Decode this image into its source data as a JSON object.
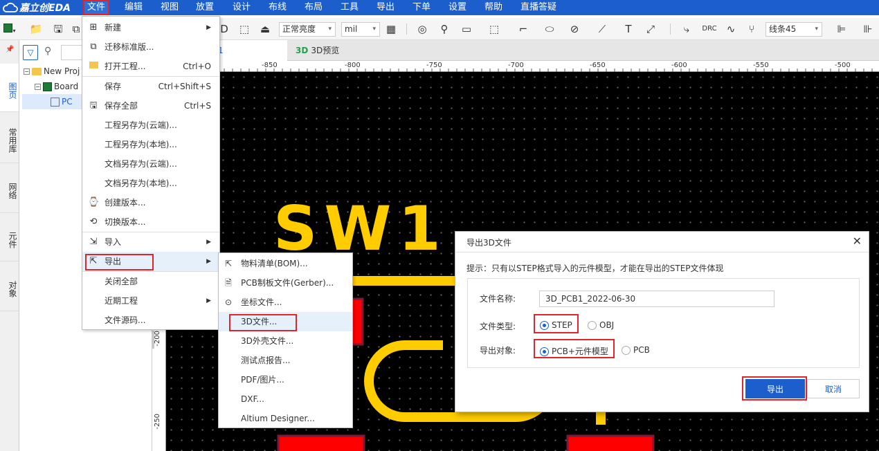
{
  "app": {
    "logo_text": "嘉立创EDA"
  },
  "menubar": {
    "items": [
      "文件",
      "编辑",
      "视图",
      "放置",
      "设计",
      "布线",
      "布局",
      "工具",
      "导出",
      "下单",
      "设置",
      "帮助",
      "直播答疑"
    ]
  },
  "toolbar": {
    "brightness_value": "正常亮度",
    "unit_value": "mil",
    "route_mode_value": "线条45",
    "drc_label": "DRC"
  },
  "sidebar": {
    "tabs": [
      "图页",
      "常用库",
      "网络",
      "元件",
      "对象"
    ]
  },
  "tree": {
    "project": "New Proj",
    "board": "Board",
    "pcb": "PC"
  },
  "doctabs": [
    {
      "label": "1"
    },
    {
      "badge": "3D",
      "label": "3D预览"
    }
  ],
  "ruler": {
    "h_labels": [
      "-850",
      "-800",
      "-750",
      "-700",
      "-650",
      "-600",
      "-550",
      "-500"
    ],
    "v_labels": [
      "-200",
      "-250"
    ]
  },
  "canvas": {
    "silk_text": "SW1"
  },
  "file_menu": {
    "items": [
      {
        "label": "新建",
        "shortcut": "",
        "submenu": true
      },
      {
        "label": "迁移标准版...",
        "shortcut": ""
      },
      {
        "label": "打开工程...",
        "shortcut": "Ctrl+O"
      },
      {
        "label": "保存",
        "shortcut": "Ctrl+Shift+S"
      },
      {
        "label": "保存全部",
        "shortcut": "Ctrl+S"
      },
      {
        "label": "工程另存为(云端)...",
        "shortcut": ""
      },
      {
        "label": "工程另存为(本地)...",
        "shortcut": ""
      },
      {
        "label": "文档另存为(云端)...",
        "shortcut": ""
      },
      {
        "label": "文档另存为(本地)...",
        "shortcut": ""
      },
      {
        "label": "创建版本...",
        "shortcut": ""
      },
      {
        "label": "切换版本...",
        "shortcut": ""
      },
      {
        "label": "导入",
        "shortcut": "",
        "submenu": true
      },
      {
        "label": "导出",
        "shortcut": "",
        "submenu": true
      },
      {
        "label": "关闭全部",
        "shortcut": ""
      },
      {
        "label": "近期工程",
        "shortcut": "",
        "submenu": true
      },
      {
        "label": "文件源码...",
        "shortcut": ""
      }
    ]
  },
  "export_menu": {
    "items": [
      "物料清单(BOM)...",
      "PCB制板文件(Gerber)...",
      "坐标文件...",
      "3D文件...",
      "3D外壳文件...",
      "测试点报告...",
      "PDF/图片...",
      "DXF...",
      "Altium Designer..."
    ]
  },
  "dialog": {
    "title": "导出3D文件",
    "hint": "提示：只有以STEP格式导入的元件模型，才能在导出的STEP文件体现",
    "filename_label": "文件名称:",
    "filename_value": "3D_PCB1_2022-06-30",
    "filetype_label": "文件类型:",
    "filetype_options": [
      "STEP",
      "OBJ"
    ],
    "filetype_selected": "STEP",
    "target_label": "导出对象:",
    "target_options": [
      "PCB+元件模型",
      "PCB"
    ],
    "target_selected": "PCB+元件模型",
    "export_button": "导出",
    "cancel_button": "取消"
  },
  "colors": {
    "accent": "#1c5fcc",
    "highlight_box": "#e0242a",
    "silkscreen": "#ffcc00",
    "pad": "#ff0000"
  }
}
